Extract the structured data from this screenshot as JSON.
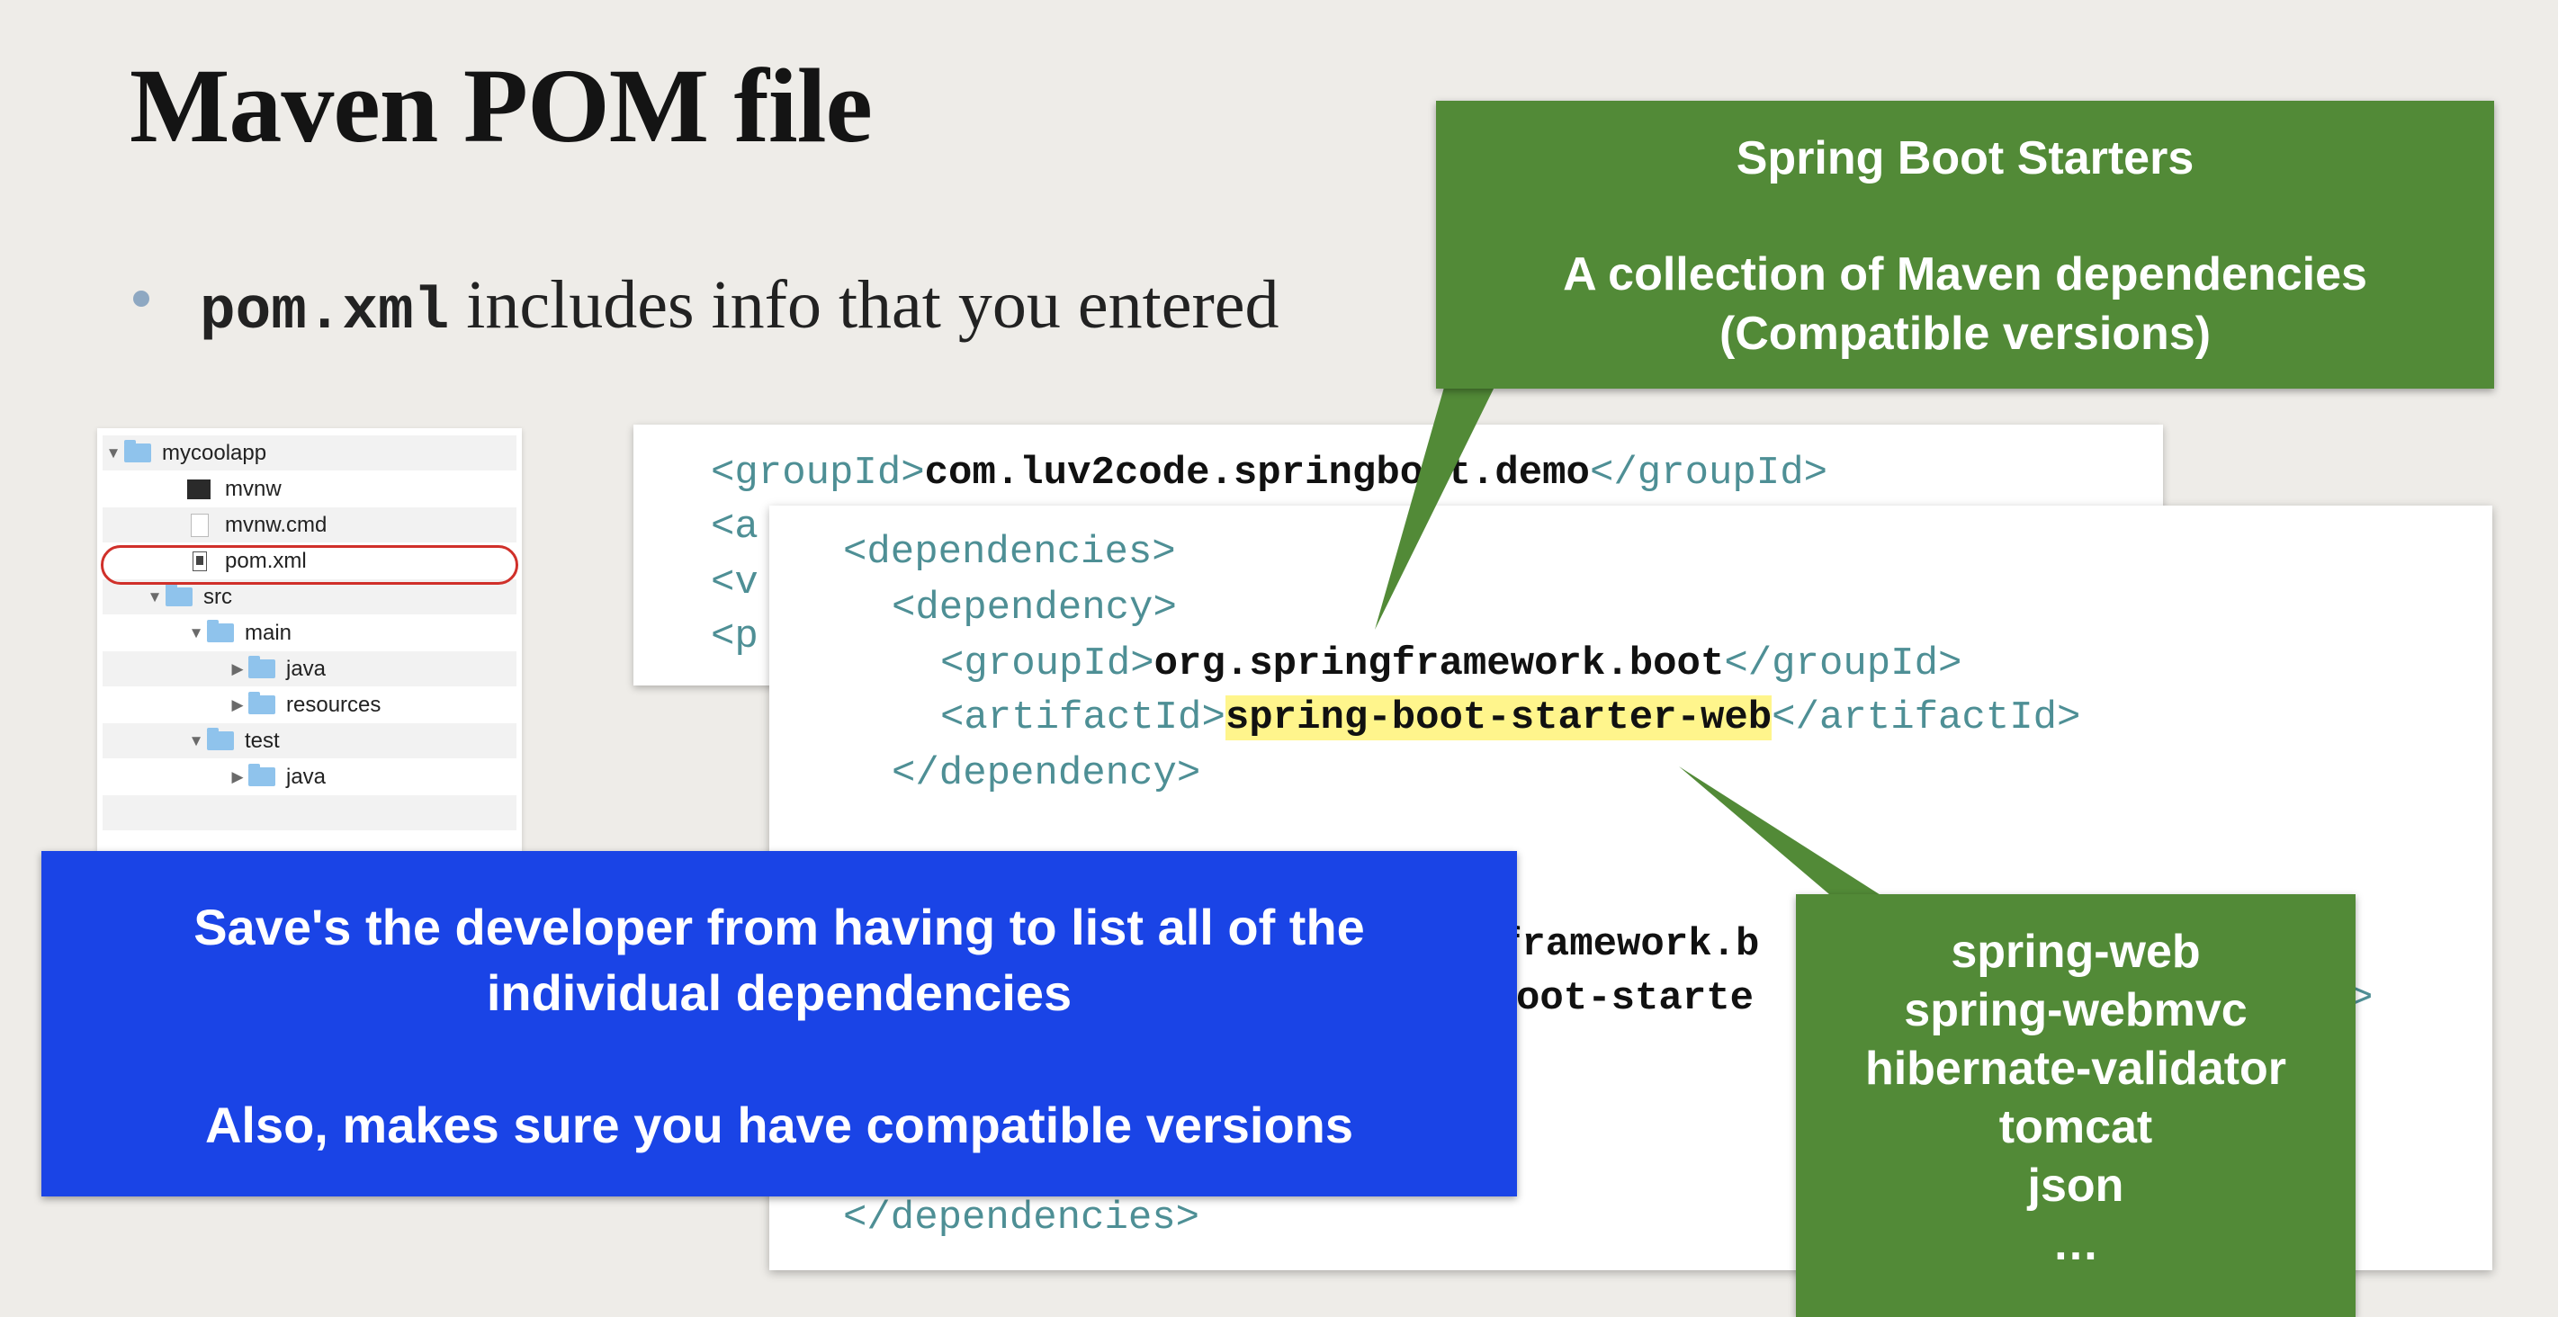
{
  "title": "Maven POM file",
  "bullet": {
    "code": "pom.xml",
    "text": " includes info that you entered"
  },
  "file_tree": [
    {
      "label": "mycoolapp",
      "type": "folder",
      "expanded": true
    },
    {
      "label": "mvnw",
      "type": "file-dark"
    },
    {
      "label": "mvnw.cmd",
      "type": "file"
    },
    {
      "label": "pom.xml",
      "type": "file-xml",
      "highlighted": true
    },
    {
      "label": "src",
      "type": "folder",
      "expanded": true
    },
    {
      "label": "main",
      "type": "folder",
      "expanded": true
    },
    {
      "label": "java",
      "type": "folder",
      "expanded": false
    },
    {
      "label": "resources",
      "type": "folder",
      "expanded": false
    },
    {
      "label": "test",
      "type": "folder",
      "expanded": true
    },
    {
      "label": "java",
      "type": "folder",
      "expanded": false
    }
  ],
  "code_back": {
    "group_open": "<groupId>",
    "group_value": "com.luv2code.springboot.demo",
    "group_close": "</groupId>",
    "stubs": [
      "<a",
      "<v",
      "<p"
    ]
  },
  "code_front": {
    "dependencies_open": "<dependencies>",
    "dependency_open": "<dependency>",
    "group_open": "<groupId>",
    "group_value": "org.springframework.boot",
    "group_close": "</groupId>",
    "artifact_open": "<artifactId>",
    "artifact_value": "spring-boot-starter-web",
    "artifact_close": "</artifactId>",
    "dependency_close": "</dependency>",
    "partial_1": "framework.b",
    "partial_2": "oot-starte",
    "partial_3": ">",
    "dependencies_close": "</dependencies>"
  },
  "callouts": {
    "starters_title": "Spring Boot Starters",
    "starters_line1": "A collection of Maven dependencies",
    "starters_line2": "(Compatible versions)",
    "blue_line1": "Save's the developer from having to list all of the",
    "blue_line2": "individual dependencies",
    "blue_line3": "Also, makes sure you have compatible versions",
    "deps_list": [
      "spring-web",
      "spring-webmvc",
      "hibernate-validator",
      "tomcat",
      "json",
      "…"
    ]
  },
  "colors": {
    "green_callout": "#528a37",
    "blue_callout": "#1a44e6",
    "xml_tag": "#4e8f95",
    "highlight": "#fff58c",
    "circle": "#d0302a"
  }
}
